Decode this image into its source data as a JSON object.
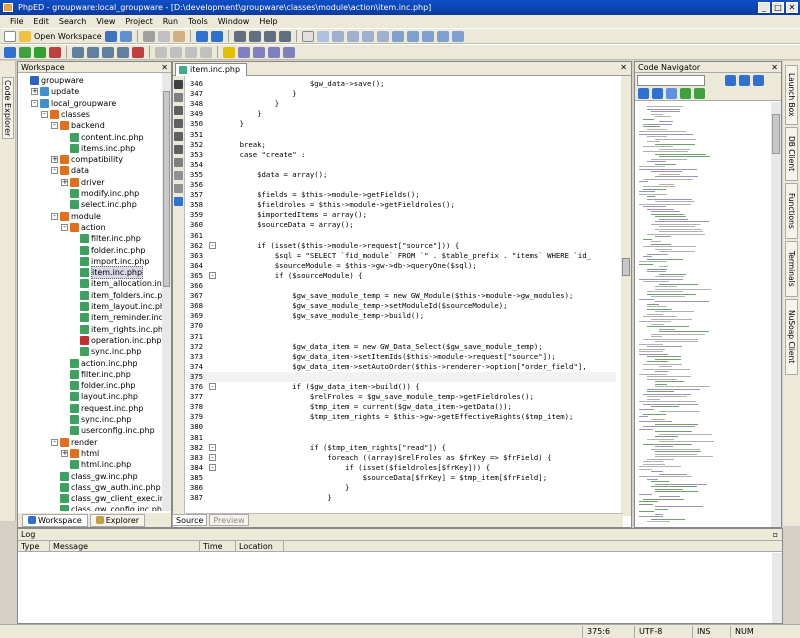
{
  "window": {
    "title": "PhpED - groupware:local_groupware - [D:\\development\\groupware\\classes\\module\\action\\item.inc.php]",
    "min": "_",
    "max": "□",
    "close": "✕"
  },
  "menu": [
    "File",
    "Edit",
    "Search",
    "View",
    "Project",
    "Run",
    "Tools",
    "Window",
    "Help"
  ],
  "toolbar": {
    "open_workspace": "Open Workspace"
  },
  "left_vtab": "Code Explorer",
  "workspace": {
    "title": "Workspace",
    "close": "✕",
    "tabs": [
      "Workspace",
      "Explorer"
    ],
    "tree": [
      {
        "label": "groupware",
        "depth": 0,
        "exp": "",
        "color": "#3060c0"
      },
      {
        "label": "update",
        "depth": 1,
        "exp": "+",
        "color": "#4090d0"
      },
      {
        "label": "local_groupware",
        "depth": 1,
        "exp": "-",
        "color": "#4090d0"
      },
      {
        "label": "classes",
        "depth": 2,
        "exp": "-",
        "color": "#e07020"
      },
      {
        "label": "backend",
        "depth": 3,
        "exp": "-",
        "color": "#e07020"
      },
      {
        "label": "content.inc.php",
        "depth": 4,
        "exp": "",
        "color": "#40a060"
      },
      {
        "label": "items.inc.php",
        "depth": 4,
        "exp": "",
        "color": "#40a060"
      },
      {
        "label": "compatibility",
        "depth": 3,
        "exp": "+",
        "color": "#e07020"
      },
      {
        "label": "data",
        "depth": 3,
        "exp": "-",
        "color": "#e07020"
      },
      {
        "label": "driver",
        "depth": 4,
        "exp": "+",
        "color": "#e07020"
      },
      {
        "label": "modify.inc.php",
        "depth": 4,
        "exp": "",
        "color": "#40a060"
      },
      {
        "label": "select.inc.php",
        "depth": 4,
        "exp": "",
        "color": "#40a060"
      },
      {
        "label": "module",
        "depth": 3,
        "exp": "-",
        "color": "#e07020"
      },
      {
        "label": "action",
        "depth": 4,
        "exp": "-",
        "color": "#e07020"
      },
      {
        "label": "filter.inc.php",
        "depth": 5,
        "exp": "",
        "color": "#40a060"
      },
      {
        "label": "folder.inc.php",
        "depth": 5,
        "exp": "",
        "color": "#40a060"
      },
      {
        "label": "import.inc.php",
        "depth": 5,
        "exp": "",
        "color": "#40a060"
      },
      {
        "label": "item.inc.php",
        "depth": 5,
        "exp": "",
        "color": "#40a060",
        "sel": true
      },
      {
        "label": "item_allocation.inc.php",
        "depth": 5,
        "exp": "",
        "color": "#40a060"
      },
      {
        "label": "item_folders.inc.php",
        "depth": 5,
        "exp": "",
        "color": "#40a060"
      },
      {
        "label": "item_layout.inc.php",
        "depth": 5,
        "exp": "",
        "color": "#40a060"
      },
      {
        "label": "item_reminder.inc.php",
        "depth": 5,
        "exp": "",
        "color": "#40a060"
      },
      {
        "label": "item_rights.inc.php",
        "depth": 5,
        "exp": "",
        "color": "#40a060"
      },
      {
        "label": "operation.inc.php",
        "depth": 5,
        "exp": "",
        "color": "#c03030"
      },
      {
        "label": "sync.inc.php",
        "depth": 5,
        "exp": "",
        "color": "#40a060"
      },
      {
        "label": "action.inc.php",
        "depth": 4,
        "exp": "",
        "color": "#40a060"
      },
      {
        "label": "filter.inc.php",
        "depth": 4,
        "exp": "",
        "color": "#40a060"
      },
      {
        "label": "folder.inc.php",
        "depth": 4,
        "exp": "",
        "color": "#40a060"
      },
      {
        "label": "layout.inc.php",
        "depth": 4,
        "exp": "",
        "color": "#40a060"
      },
      {
        "label": "request.inc.php",
        "depth": 4,
        "exp": "",
        "color": "#40a060"
      },
      {
        "label": "sync.inc.php",
        "depth": 4,
        "exp": "",
        "color": "#40a060"
      },
      {
        "label": "userconfig.inc.php",
        "depth": 4,
        "exp": "",
        "color": "#40a060"
      },
      {
        "label": "render",
        "depth": 3,
        "exp": "-",
        "color": "#e07020"
      },
      {
        "label": "html",
        "depth": 4,
        "exp": "+",
        "color": "#e07020"
      },
      {
        "label": "html.inc.php",
        "depth": 4,
        "exp": "",
        "color": "#40a060"
      },
      {
        "label": "class_gw.inc.php",
        "depth": 3,
        "exp": "",
        "color": "#40a060"
      },
      {
        "label": "class_gw_auth.inc.php",
        "depth": 3,
        "exp": "",
        "color": "#40a060"
      },
      {
        "label": "class_gw_client_exec.inc.php",
        "depth": 3,
        "exp": "",
        "color": "#40a060"
      },
      {
        "label": "class_gw_config.inc.php",
        "depth": 3,
        "exp": "",
        "color": "#40a060"
      }
    ]
  },
  "editor": {
    "tab": "item.inc.php",
    "close": "✕",
    "bottom_tabs": [
      "Source",
      "Preview"
    ],
    "lines": [
      {
        "n": "346",
        "code": "                    $gw_data->save();",
        "fold": ""
      },
      {
        "n": "347",
        "code": "                }",
        "fold": ""
      },
      {
        "n": "348",
        "code": "            }",
        "fold": ""
      },
      {
        "n": "349",
        "code": "        }",
        "fold": ""
      },
      {
        "n": "350",
        "code": "    }",
        "fold": ""
      },
      {
        "n": "351",
        "code": "",
        "fold": ""
      },
      {
        "n": "352",
        "code": "    break;",
        "fold": ""
      },
      {
        "n": "353",
        "code": "    case \"create\" :",
        "fold": ""
      },
      {
        "n": "354",
        "code": "",
        "fold": ""
      },
      {
        "n": "355",
        "code": "        $data = array();",
        "fold": ""
      },
      {
        "n": "356",
        "code": "",
        "fold": ""
      },
      {
        "n": "357",
        "code": "        $fields = $this->module->getFields();",
        "fold": ""
      },
      {
        "n": "358",
        "code": "        $fieldroles = $this->module->getFieldroles();",
        "fold": ""
      },
      {
        "n": "359",
        "code": "        $importedItems = array();",
        "fold": ""
      },
      {
        "n": "360",
        "code": "        $sourceData = array();",
        "fold": ""
      },
      {
        "n": "361",
        "code": "",
        "fold": ""
      },
      {
        "n": "362",
        "code": "        if (isset($this->module->request[\"source\"])) {",
        "fold": "-"
      },
      {
        "n": "363",
        "code": "            $sql = \"SELECT `fid_module` FROM `\" . $table_prefix . \"items` WHERE `id_",
        "fold": ""
      },
      {
        "n": "364",
        "code": "            $sourceModule = $this->gw->db->queryOne($sql);",
        "fold": ""
      },
      {
        "n": "365",
        "code": "            if ($sourceModule) {",
        "fold": "-"
      },
      {
        "n": "366",
        "code": "",
        "fold": ""
      },
      {
        "n": "367",
        "code": "                $gw_save_module_temp = new GW_Module($this->module->gw_modules);",
        "fold": ""
      },
      {
        "n": "368",
        "code": "                $gw_save_module_temp->setModuleId($sourceModule);",
        "fold": ""
      },
      {
        "n": "369",
        "code": "                $gw_save_module_temp->build();",
        "fold": ""
      },
      {
        "n": "370",
        "code": "",
        "fold": ""
      },
      {
        "n": "371",
        "code": "",
        "fold": ""
      },
      {
        "n": "372",
        "code": "                $gw_data_item = new GW_Data_Select($gw_save_module_temp);",
        "fold": ""
      },
      {
        "n": "373",
        "code": "                $gw_data_item->setItemIds($this->module->request[\"source\"]);",
        "fold": ""
      },
      {
        "n": "374",
        "code": "                $gw_data_item->setAutoOrder($this->renderer->option[\"order_field\"],",
        "fold": ""
      },
      {
        "n": "375",
        "code": "",
        "fold": "",
        "hl": true
      },
      {
        "n": "376",
        "code": "                if ($gw_data_item->build()) {",
        "fold": "-"
      },
      {
        "n": "377",
        "code": "                    $relFroles = $gw_save_module_temp->getFieldroles();",
        "fold": ""
      },
      {
        "n": "378",
        "code": "                    $tmp_item = current($gw_data_item->getData());",
        "fold": ""
      },
      {
        "n": "379",
        "code": "                    $tmp_item_rights = $this->gw->getEffectiveRights($tmp_item);",
        "fold": ""
      },
      {
        "n": "380",
        "code": "",
        "fold": ""
      },
      {
        "n": "381",
        "code": "",
        "fold": ""
      },
      {
        "n": "382",
        "code": "                    if ($tmp_item_rights[\"read\"]) {",
        "fold": "-"
      },
      {
        "n": "383",
        "code": "                        foreach ((array)$relFroles as $frKey => $frField) {",
        "fold": "-"
      },
      {
        "n": "384",
        "code": "                            if (isset($fieldroles[$frKey])) {",
        "fold": "-"
      },
      {
        "n": "385",
        "code": "                                $sourceData[$frKey] = $tmp_item[$frField];",
        "fold": ""
      },
      {
        "n": "386",
        "code": "                            }",
        "fold": ""
      },
      {
        "n": "387",
        "code": "                        }",
        "fold": ""
      }
    ]
  },
  "navigator": {
    "title": "Code Navigator",
    "close": "✕"
  },
  "right_vtabs": [
    "Launch Box",
    "DB Client",
    "Functions",
    "Terminals",
    "NuSoap Client"
  ],
  "log": {
    "title": "Log",
    "columns": [
      "Type",
      "Message",
      "Time",
      "Location"
    ]
  },
  "status": {
    "position": "375:6",
    "encoding": "UTF-8",
    "ins": "INS",
    "num": "NUM"
  }
}
